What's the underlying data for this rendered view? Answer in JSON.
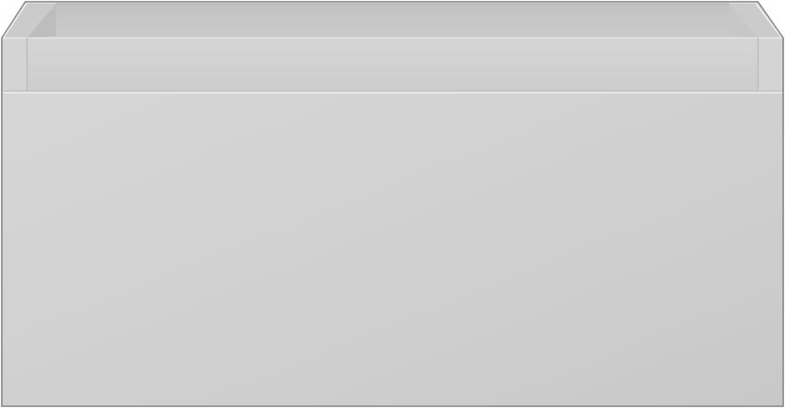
{
  "image": {
    "subject": "drawer-unit",
    "colors": {
      "background": "#ffffff",
      "body": "#cecece",
      "front_light": "#d3d3d3",
      "front_dark": "#c9c9c9",
      "rim": "#d2d2d2",
      "inner_wall": "#c5c5c5",
      "inner_back": "#bfbfbf",
      "edge_highlight": "#e6e6e6",
      "edge_shadow": "#a9a9a9",
      "outline": "#8c8c8c"
    }
  }
}
